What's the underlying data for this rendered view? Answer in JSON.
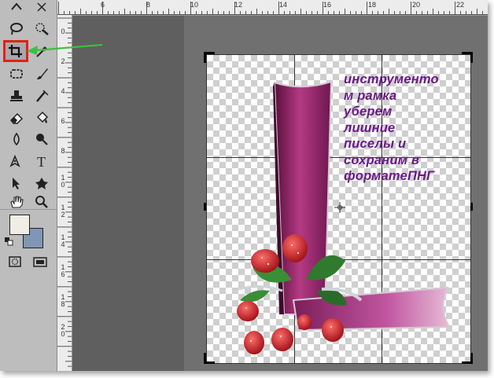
{
  "app": {
    "accent_highlight": "#e0221b",
    "arrow_color": "#3fbf3f"
  },
  "toolbar": {
    "tools": [
      {
        "id": "lasso",
        "icon": "lasso-icon"
      },
      {
        "id": "quick-select",
        "icon": "quick-select-icon"
      },
      {
        "id": "crop",
        "icon": "crop-icon",
        "selected": true
      },
      {
        "id": "eyedropper",
        "icon": "eyedropper-icon"
      },
      {
        "id": "healing",
        "icon": "spot-healing-icon"
      },
      {
        "id": "brush",
        "icon": "brush-icon"
      },
      {
        "id": "stamp",
        "icon": "clone-stamp-icon"
      },
      {
        "id": "history-brush",
        "icon": "history-brush-icon"
      },
      {
        "id": "eraser",
        "icon": "eraser-icon"
      },
      {
        "id": "paint-bucket",
        "icon": "paint-bucket-icon"
      },
      {
        "id": "blur",
        "icon": "blur-icon"
      },
      {
        "id": "dodge",
        "icon": "dodge-icon"
      },
      {
        "id": "pen",
        "icon": "pen-icon"
      },
      {
        "id": "type",
        "icon": "type-icon"
      },
      {
        "id": "path-select",
        "icon": "path-selection-icon"
      },
      {
        "id": "shape",
        "icon": "custom-shape-icon"
      },
      {
        "id": "hand",
        "icon": "hand-icon"
      },
      {
        "id": "zoom",
        "icon": "zoom-icon"
      },
      {
        "id": "quick-mask",
        "icon": "quick-mask-icon"
      },
      {
        "id": "screen-mode",
        "icon": "screen-mode-icon"
      }
    ],
    "foreground_color": "#f1ede5",
    "background_color": "#7f97b5"
  },
  "rulers": {
    "top_labels": [
      "6",
      "8",
      "10",
      "12",
      "14",
      "16",
      "18",
      "20",
      "22"
    ],
    "left_labels": [
      "0",
      "2",
      "4",
      "6",
      "8",
      "1\n0",
      "1\n2",
      "1\n4",
      "1\n6",
      "1\n8",
      "2\n0"
    ]
  },
  "canvas": {
    "caption": "инструменто\nм рамка\nуберем\nлишние\nписелы и\nсохраним в\nформатеПНГ"
  }
}
